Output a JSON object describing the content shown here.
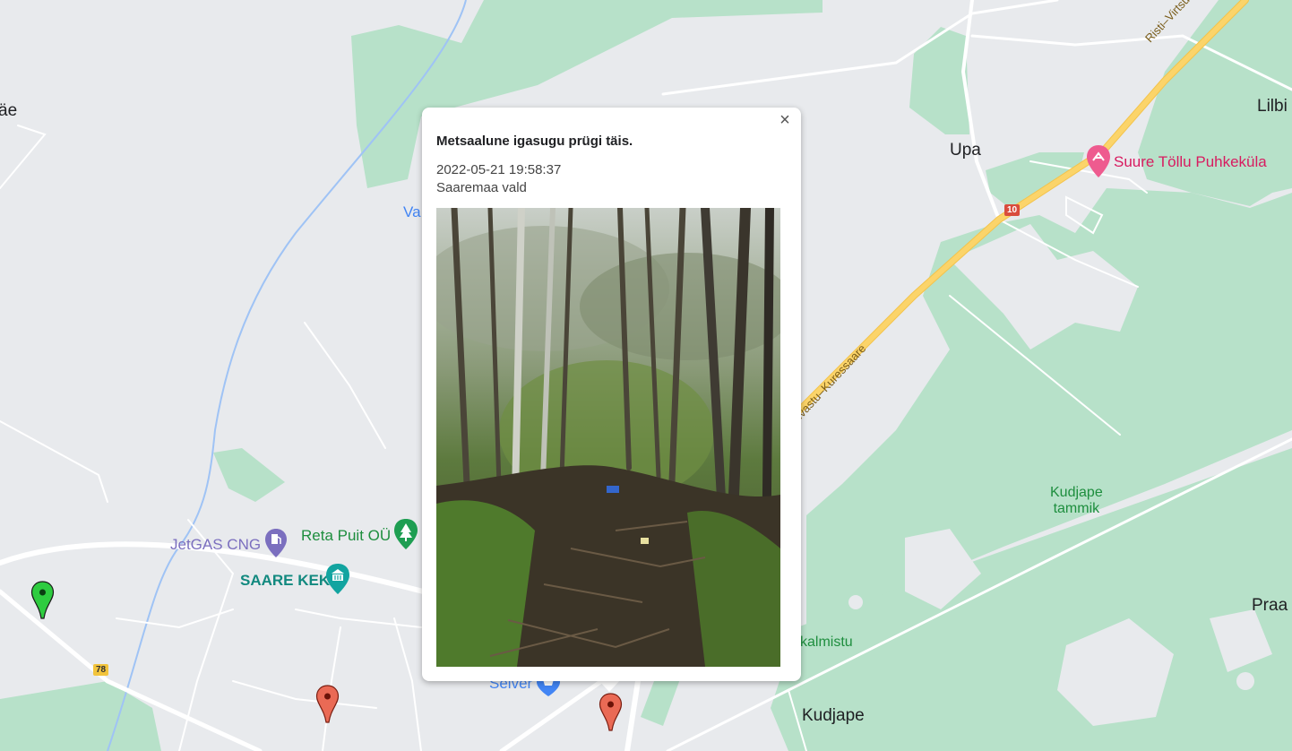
{
  "map": {
    "labels": {
      "aee": "äe",
      "upa": "Upa",
      "lilbi": "Lilbi",
      "va": "Va",
      "kudjape": "Kudjape",
      "praa": "Praa",
      "suure_tollu": "Suure Töllu Puhkeküla",
      "jetgas": "JetGAS CNG",
      "reta_puit": "Reta Puit OÜ",
      "saare_kek": "SAARE KEK",
      "selver": "Selver",
      "kalmistu": "kalmistu",
      "kudjape_tammik_1": "Kudjape",
      "kudjape_tammik_2": "tammik",
      "road_10_name_top": "Risti–Virtsu–Kuiva",
      "road_10_name_mid": "ivastu–Kuressaare"
    },
    "shields": {
      "road_10": "10",
      "road_78": "78"
    },
    "colors": {
      "background": "#e8eaed",
      "forest": "#b7e1c9",
      "road": "#ffffff",
      "highway": "#fbd46a",
      "river": "#9fc3f5",
      "marker_red": "#ea6a55",
      "marker_green": "#2ecc40"
    }
  },
  "popup": {
    "title": "Metsaalune igasugu prügi täis.",
    "datetime": "2022-05-21 19:58:37",
    "area": "Saaremaa vald",
    "close_glyph": "×"
  },
  "icons": {
    "close": "close-icon",
    "marker": "map-pin-icon",
    "gas": "gas-station-icon",
    "tree": "tree-icon",
    "museum": "museum-icon",
    "shopping": "shopping-icon",
    "resort": "resort-icon"
  }
}
